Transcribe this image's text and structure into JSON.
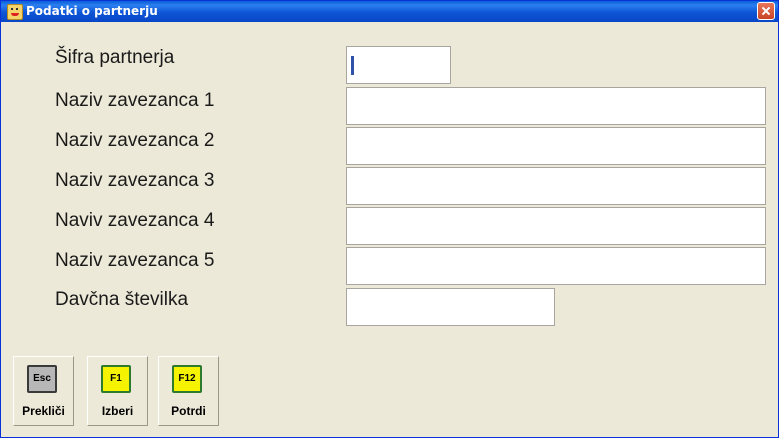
{
  "window": {
    "title": "Podatki o partnerju"
  },
  "form": {
    "fields": [
      {
        "label": "Šifra partnerja",
        "value": ""
      },
      {
        "label": "Naziv zavezanca 1",
        "value": ""
      },
      {
        "label": "Naziv zavezanca 2",
        "value": ""
      },
      {
        "label": "Naziv zavezanca 3",
        "value": ""
      },
      {
        "label": "Naviv zavezanca 4",
        "value": ""
      },
      {
        "label": "Naziv zavezanca 5",
        "value": ""
      },
      {
        "label": "Davčna številka",
        "value": ""
      }
    ]
  },
  "buttons": [
    {
      "key": "Esc",
      "label": "Prekliči",
      "key_color": "#b7b7b7"
    },
    {
      "key": "F1",
      "label": "Izberi",
      "key_color": "#f5f300"
    },
    {
      "key": "F12",
      "label": "Potrdi",
      "key_color": "#f5f300"
    }
  ]
}
